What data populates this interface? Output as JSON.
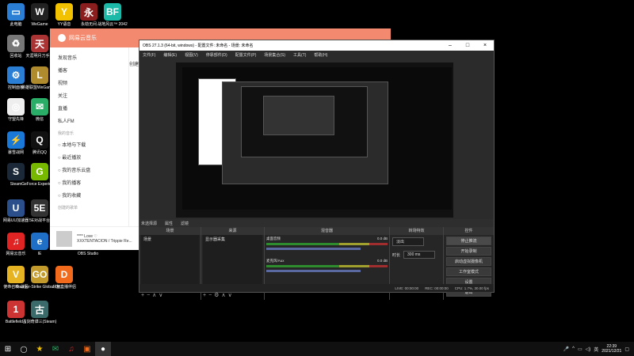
{
  "desktop_icons": [
    {
      "label": "此电脑",
      "color": "#2a7fd4",
      "glyph": "▭",
      "icon": "computer-icon"
    },
    {
      "label": "WeGame",
      "color": "#222",
      "glyph": "W",
      "icon": "wegame-icon"
    },
    {
      "label": "YY语音",
      "color": "#f2c200",
      "glyph": "Y",
      "icon": "yy-icon"
    },
    {
      "label": "永劫无间",
      "color": "#8a1e1e",
      "glyph": "永",
      "icon": "naraka-icon"
    },
    {
      "label": "战地风云™ 2042",
      "color": "#1cb8a8",
      "glyph": "BF",
      "icon": "battlefield-2042-icon"
    },
    {
      "label": "回收站",
      "color": "#777",
      "glyph": "♻",
      "icon": "recycle-bin-icon"
    },
    {
      "label": "天涯明月刀手游",
      "color": "#a33",
      "glyph": "天",
      "icon": "tianya-icon"
    },
    {
      "label": "控制面板",
      "color": "#2a7fd4",
      "glyph": "⚙",
      "icon": "control-panel-icon"
    },
    {
      "label": "英雄联盟WeGame版",
      "color": "#b08b2e",
      "glyph": "L",
      "icon": "lol-icon"
    },
    {
      "label": "守望先锋",
      "color": "#eee",
      "glyph": "◎",
      "icon": "overwatch-icon"
    },
    {
      "label": "微信",
      "color": "#2aae67",
      "glyph": "✉",
      "icon": "wechat-icon"
    },
    {
      "label": "暴雪战网",
      "color": "#1a78d6",
      "glyph": "⚡",
      "icon": "battlenet-icon"
    },
    {
      "label": "腾讯QQ",
      "color": "#111",
      "glyph": "Q",
      "icon": "qq-icon"
    },
    {
      "label": "Steam",
      "color": "#1b2838",
      "glyph": "S",
      "icon": "steam-icon"
    },
    {
      "label": "GeForce Experience",
      "color": "#76b900",
      "glyph": "G",
      "icon": "geforce-icon"
    },
    {
      "label": "网易UU加速器",
      "color": "#2a4f8a",
      "glyph": "U",
      "icon": "uu-icon"
    },
    {
      "label": "5E对战平台",
      "color": "#333",
      "glyph": "5E",
      "icon": "5e-icon"
    },
    {
      "label": "网易云音乐",
      "color": "#e02424",
      "glyph": "♫",
      "icon": "netease-music-icon"
    },
    {
      "label": "IE",
      "color": "#1f6fc7",
      "glyph": "e",
      "icon": "ie-icon"
    },
    {
      "label": "OBS Studio",
      "color": "#302e31",
      "glyph": "●",
      "icon": "obs-icon"
    },
    {
      "label": "使命召唤 战区",
      "color": "#e6b422",
      "glyph": "V",
      "icon": "cod-icon"
    },
    {
      "label": "Counter-Strike Global Off...",
      "color": "#c29b2c",
      "glyph": "GO",
      "icon": "csgo-icon"
    },
    {
      "label": "斗鱼直播伴侣",
      "color": "#f26a1b",
      "glyph": "D",
      "icon": "douyu-icon"
    },
    {
      "label": "Battlefield 1",
      "color": "#c33",
      "glyph": "1",
      "icon": "battlefield-1-icon"
    },
    {
      "label": "古剑奇谭三(Steam)",
      "color": "#3a6a6a",
      "glyph": "古",
      "icon": "gujian-icon"
    }
  ],
  "netease": {
    "title": "网易云音乐",
    "nav": [
      "发现音乐",
      "播客",
      "视频",
      "关注",
      "直播",
      "私人FM"
    ],
    "section_mine": "我的音乐",
    "mine": [
      "本地与下载",
      "最近播放",
      "我的音乐云盘",
      "我的播客",
      "我的收藏"
    ],
    "section_playlists": "创建的歌单",
    "peek": "创建",
    "now_playing": "**** Love ♡",
    "artist": "XXXTENTACION / Trippie Re..."
  },
  "obs": {
    "title": "OBS 27.1.3 (64-bit, windows) - 配置文件: 未命名 - 场景: 未命名",
    "menu": [
      "文件(F)",
      "编辑(E)",
      "视图(V)",
      "停靠部件(D)",
      "配置文件(P)",
      "场景集合(S)",
      "工具(T)",
      "帮助(H)"
    ],
    "source_hint": "未选择源",
    "props_button": "属性",
    "filter_button": "滤镜",
    "panels": {
      "scenes": "场景",
      "sources": "来源",
      "mixer": "混音器",
      "transitions": "转场特效",
      "controls": "控件"
    },
    "scene_item": "场景",
    "source_item": "显示器采集",
    "mixer": [
      {
        "name": "桌面音频",
        "db": "0.0 dB"
      },
      {
        "name": "麦克风/Aux",
        "db": "0.0 dB"
      }
    ],
    "transition": {
      "type": "淡出",
      "duration_label": "时长",
      "duration": "300 ms"
    },
    "controls": [
      "停止推流",
      "开始录制",
      "启动虚拟摄像机",
      "工作室模式",
      "设置",
      "退出"
    ],
    "status": [
      "LIVE: 00:00:00",
      "REC: 00:00:00",
      "CPU: 1.7%, 30.00 fps"
    ]
  },
  "taskbar": {
    "time": "22:39",
    "date": "2021/12/21",
    "lang": "英"
  }
}
